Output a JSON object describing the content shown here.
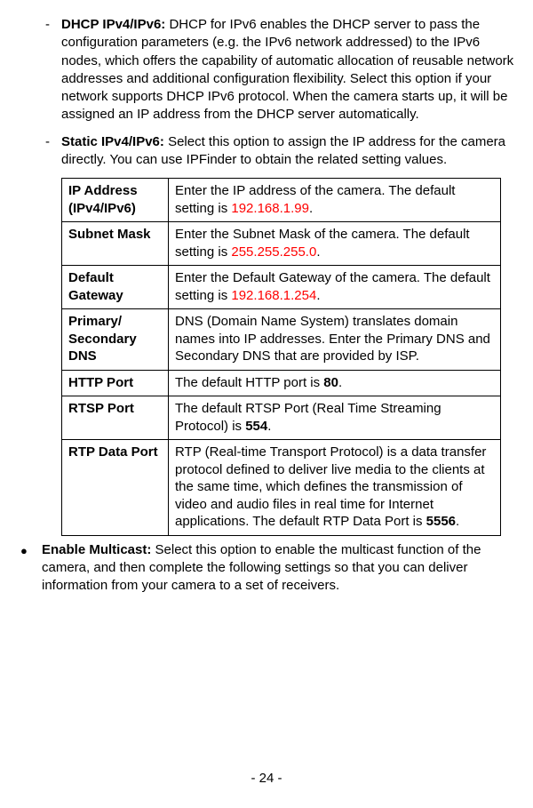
{
  "dhcp": {
    "title": "DHCP IPv4/IPv6:",
    "text": " DHCP for IPv6 enables the DHCP server to pass the configuration parameters (e.g. the IPv6 network addressed) to the IPv6 nodes, which offers the capability of automatic allocation of reusable network addresses and additional configuration flexibility. Select this option if your network supports DHCP IPv6 protocol. When the camera starts up, it will be assigned an IP address from the DHCP server automatically."
  },
  "static": {
    "title": "Static IPv4/IPv6:",
    "text": " Select this option to assign the IP address for the camera directly. You can use IPFinder to obtain the related setting values."
  },
  "table": {
    "ip_label": "IP Address (IPv4/IPv6)",
    "ip_val_a": "Enter the IP address of the camera. The default setting is ",
    "ip_val_red": "192.168.1.99",
    "ip_val_b": ".",
    "subnet_label": "Subnet Mask",
    "subnet_val_a": "Enter the Subnet Mask of the camera. The default setting is ",
    "subnet_val_red": "255.255.255.0",
    "subnet_val_b": ".",
    "gateway_label": "Default Gateway",
    "gateway_val_a": "Enter the Default Gateway of the camera. The default setting is ",
    "gateway_val_red": "192.168.1.254",
    "gateway_val_b": ".",
    "dns_label": "Primary/ Secondary DNS",
    "dns_val": "DNS (Domain Name System) translates domain names into IP addresses. Enter the Primary DNS and Secondary DNS that are provided by ISP.",
    "http_label": "HTTP Port",
    "http_val_a": "The default HTTP port is ",
    "http_val_b": "80",
    "http_val_c": ".",
    "rtsp_label": "RTSP Port",
    "rtsp_val_a": "The default RTSP Port (Real Time Streaming Protocol) is ",
    "rtsp_val_b": "554",
    "rtsp_val_c": ".",
    "rtp_label": "RTP Data Port",
    "rtp_val_a": "RTP (Real-time Transport Protocol) is a data transfer protocol defined to deliver live media to the clients at the same time, which defines the transmission of video and audio files in real time for Internet applications. The default RTP Data Port is ",
    "rtp_val_b": "5556",
    "rtp_val_c": "."
  },
  "multicast": {
    "title": "Enable Multicast:",
    "text": " Select this option to enable the multicast function of the camera, and then complete the following settings so that you can deliver information from your camera to a set of receivers."
  },
  "page": "- 24 -"
}
